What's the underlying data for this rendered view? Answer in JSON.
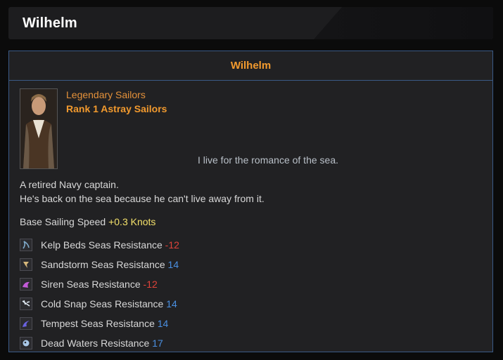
{
  "header": {
    "title": "Wilhelm"
  },
  "panel": {
    "title": "Wilhelm",
    "faction": "Legendary Sailors",
    "rank": "Rank 1 Astray Sailors",
    "quote": "I live for the romance of the sea.",
    "description_lines": [
      "A retired Navy captain.",
      "He's back on the sea because he can't live away from it."
    ],
    "speed": {
      "label": "Base Sailing Speed",
      "value": "+0.3 Knots"
    },
    "resistances": [
      {
        "label": "Kelp Beds Seas Resistance",
        "value": "-12",
        "icon": "kelp-icon"
      },
      {
        "label": "Sandstorm Seas Resistance",
        "value": "14",
        "icon": "sandstorm-icon"
      },
      {
        "label": "Siren Seas Resistance",
        "value": "-12",
        "icon": "siren-icon"
      },
      {
        "label": "Cold Snap Seas Resistance",
        "value": "14",
        "icon": "cold-snap-icon"
      },
      {
        "label": "Tempest Seas Resistance",
        "value": "14",
        "icon": "tempest-icon"
      },
      {
        "label": "Dead Waters Resistance",
        "value": "17",
        "icon": "dead-waters-icon"
      }
    ]
  },
  "colors": {
    "accent": "#f29a2e",
    "negative": "#e0433a",
    "positive": "#4a8fe0",
    "speed": "#f3e06a",
    "border": "#3a5a86"
  }
}
